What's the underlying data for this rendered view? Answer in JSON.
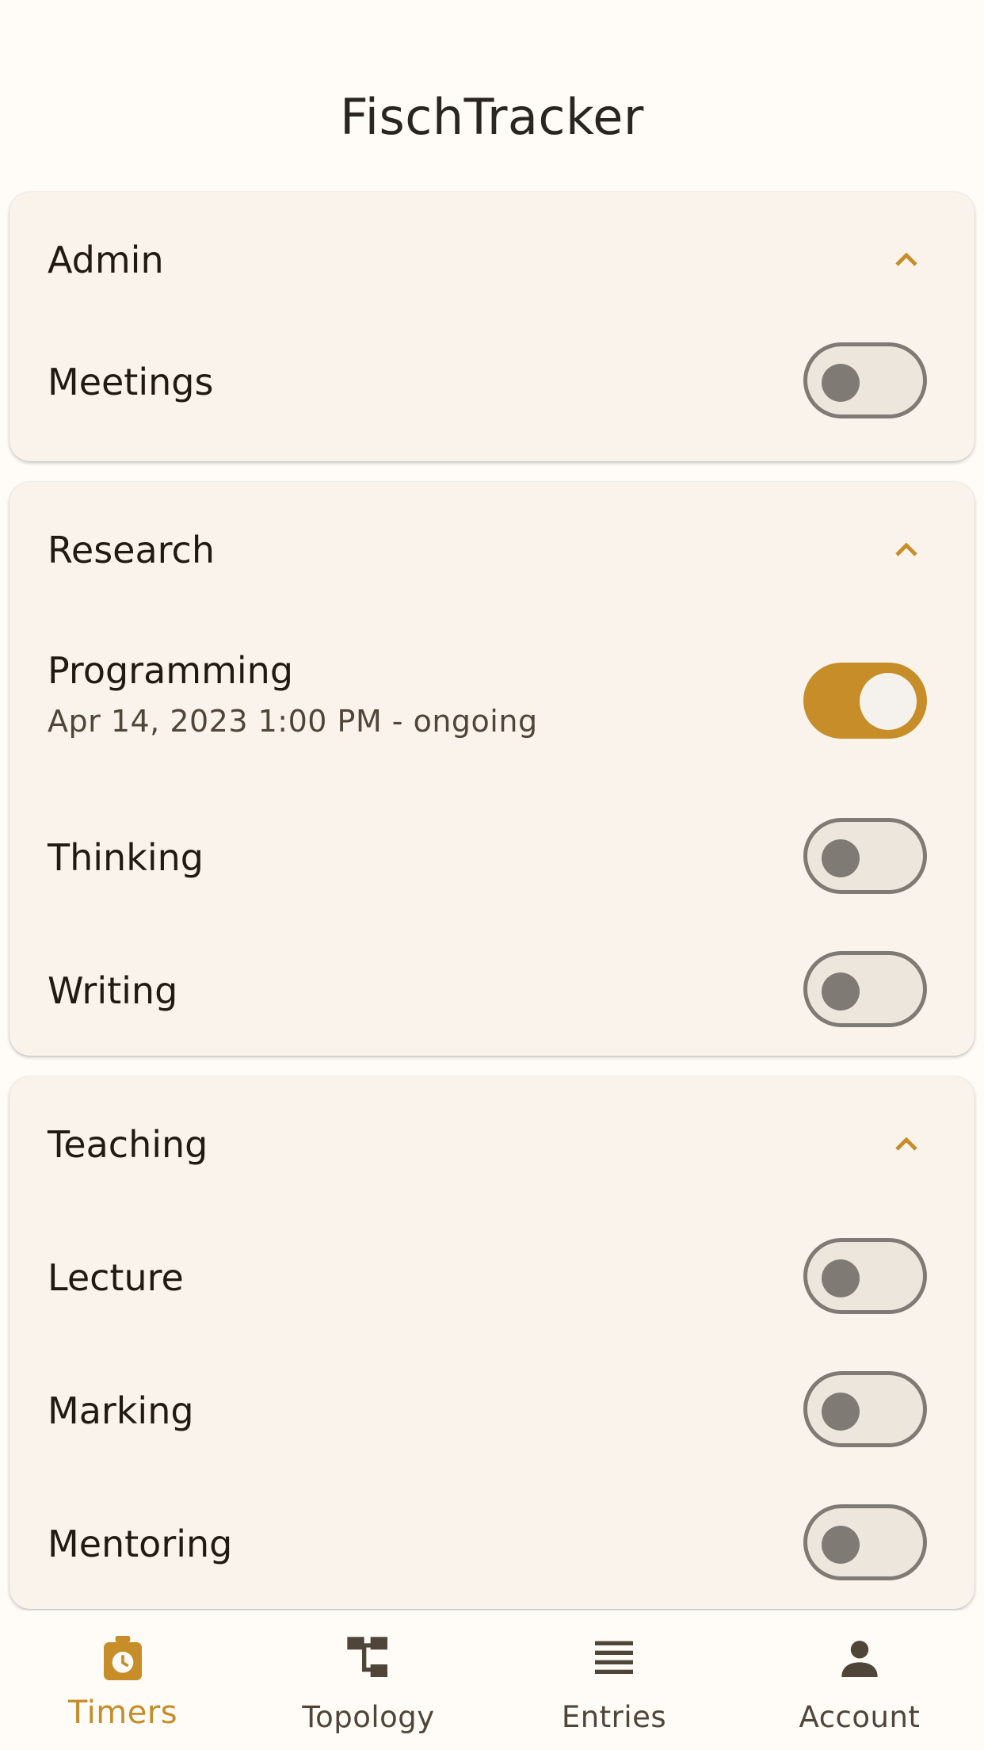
{
  "app": {
    "title": "FischTracker"
  },
  "colors": {
    "accent": "#c68d28",
    "background": "#fffbf7",
    "card": "#faf3ec",
    "switch_off": "#7f7a74"
  },
  "groups": [
    {
      "title": "Admin",
      "expanded": true,
      "icon": "chevron-up-icon",
      "items": [
        {
          "label": "Meetings",
          "subtitle": "",
          "on": false
        }
      ]
    },
    {
      "title": "Research",
      "expanded": true,
      "icon": "chevron-up-icon",
      "items": [
        {
          "label": "Programming",
          "subtitle": "Apr 14, 2023 1:00 PM - ongoing",
          "on": true
        },
        {
          "label": "Thinking",
          "subtitle": "",
          "on": false
        },
        {
          "label": "Writing",
          "subtitle": "",
          "on": false
        }
      ]
    },
    {
      "title": "Teaching",
      "expanded": true,
      "icon": "chevron-up-icon",
      "items": [
        {
          "label": "Lecture",
          "subtitle": "",
          "on": false
        },
        {
          "label": "Marking",
          "subtitle": "",
          "on": false
        },
        {
          "label": "Mentoring",
          "subtitle": "",
          "on": false
        }
      ]
    }
  ],
  "bottom_nav": {
    "items": [
      {
        "label": "Timers",
        "icon": "timer-icon",
        "active": true
      },
      {
        "label": "Topology",
        "icon": "tree-icon",
        "active": false
      },
      {
        "label": "Entries",
        "icon": "list-icon",
        "active": false
      },
      {
        "label": "Account",
        "icon": "person-icon",
        "active": false
      }
    ]
  }
}
